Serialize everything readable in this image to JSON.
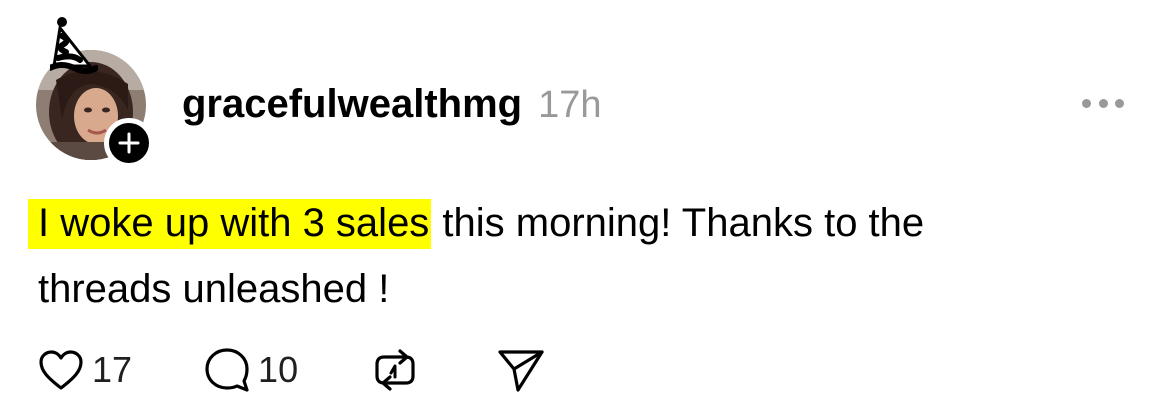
{
  "post": {
    "username": "gracefulwealthmg",
    "timestamp": "17h",
    "text_highlighted": "I woke up with 3 sales",
    "text_rest_line1": " this morning! Thanks to the",
    "text_line2": "threads unleashed !",
    "highlight_color": "#ffff00",
    "likes": "17",
    "replies": "10"
  },
  "icons": {
    "like": "heart-icon",
    "reply": "speech-bubble-icon",
    "repost": "repost-icon",
    "share": "send-icon",
    "more": "more-dots-icon",
    "follow": "plus-icon",
    "decoration": "party-hat-icon"
  }
}
